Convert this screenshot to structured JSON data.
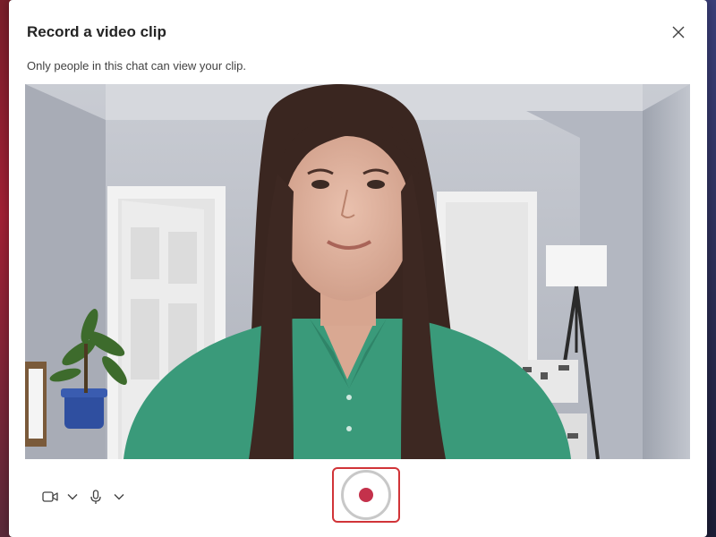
{
  "dialog": {
    "title": "Record a video clip",
    "subtitle": "Only people in this chat can view your clip.",
    "close_icon": "close-icon"
  },
  "video_preview": {
    "content": "camera-preview"
  },
  "toolbar": {
    "camera_icon": "camera-icon",
    "camera_options_icon": "chevron-down-icon",
    "mic_icon": "microphone-icon",
    "mic_options_icon": "chevron-down-icon",
    "record_icon": "record-icon"
  },
  "colors": {
    "record_accent": "#c4314b",
    "record_highlight": "#d13438",
    "shirt": "#3a9a7a",
    "wall": "#b7bcc8"
  }
}
